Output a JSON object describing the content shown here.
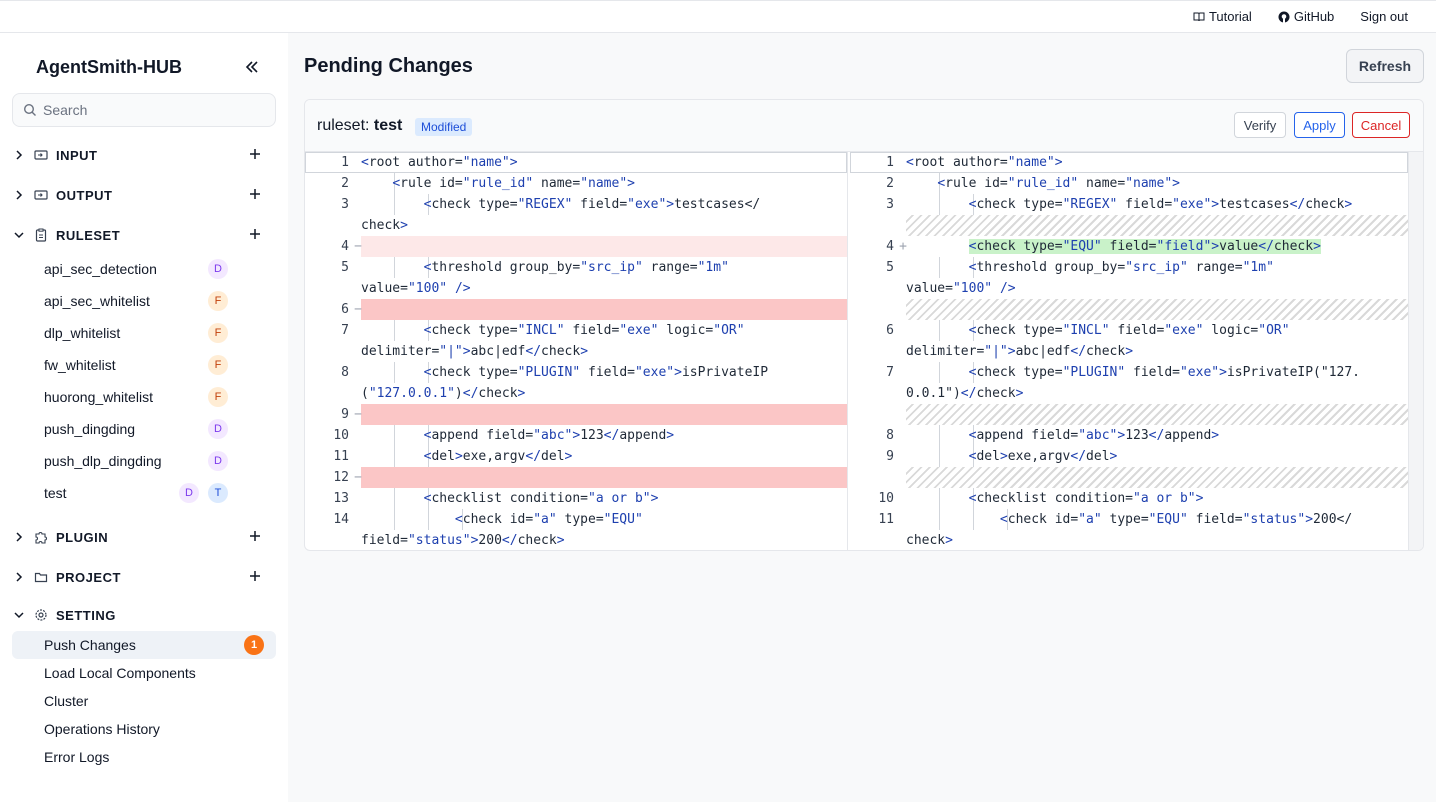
{
  "topbar": {
    "tutorial": "Tutorial",
    "github": "GitHub",
    "signout": "Sign out"
  },
  "sidebar": {
    "brand": "AgentSmith-HUB",
    "search_placeholder": "Search",
    "sections": {
      "input": "INPUT",
      "output": "OUTPUT",
      "ruleset": "RULESET",
      "plugin": "PLUGIN",
      "project": "PROJECT",
      "setting": "SETTING"
    },
    "rulesets": [
      {
        "label": "api_sec_detection",
        "badges": [
          "D"
        ]
      },
      {
        "label": "api_sec_whitelist",
        "badges": [
          "F"
        ]
      },
      {
        "label": "dlp_whitelist",
        "badges": [
          "F"
        ]
      },
      {
        "label": "fw_whitelist",
        "badges": [
          "F"
        ]
      },
      {
        "label": "huorong_whitelist",
        "badges": [
          "F"
        ]
      },
      {
        "label": "push_dingding",
        "badges": [
          "D"
        ]
      },
      {
        "label": "push_dlp_dingding",
        "badges": [
          "D"
        ]
      },
      {
        "label": "test",
        "badges": [
          "D",
          "T"
        ]
      }
    ],
    "settings": [
      {
        "label": "Push Changes",
        "count": "1"
      },
      {
        "label": "Load Local Components"
      },
      {
        "label": "Cluster"
      },
      {
        "label": "Operations History"
      },
      {
        "label": "Error Logs"
      }
    ]
  },
  "main": {
    "title": "Pending Changes",
    "refresh": "Refresh",
    "change": {
      "type_label": "ruleset:",
      "name": "test",
      "status": "Modified",
      "verify": "Verify",
      "apply": "Apply",
      "cancel": "Cancel"
    }
  },
  "diff": {
    "left": [
      {
        "n": "1",
        "mark": "",
        "text": "<root author=\"name\">"
      },
      {
        "n": "2",
        "mark": "",
        "text": "    <rule id=\"rule_id\" name=\"name\">"
      },
      {
        "n": "3",
        "mark": "",
        "text": "        <check type=\"REGEX\" field=\"exe\">testcases</"
      },
      {
        "n": "",
        "mark": "",
        "text": "check>"
      },
      {
        "n": "4",
        "mark": "−",
        "text": ""
      },
      {
        "n": "5",
        "mark": "",
        "text": "        <threshold group_by=\"src_ip\" range=\"1m\""
      },
      {
        "n": "",
        "mark": "",
        "text": "value=\"100\" />"
      },
      {
        "n": "6",
        "mark": "−",
        "text": ""
      },
      {
        "n": "7",
        "mark": "",
        "text": "        <check type=\"INCL\" field=\"exe\" logic=\"OR\""
      },
      {
        "n": "",
        "mark": "",
        "text": "delimiter=\"|\">abc|edf</check>"
      },
      {
        "n": "8",
        "mark": "",
        "text": "        <check type=\"PLUGIN\" field=\"exe\">isPrivateIP"
      },
      {
        "n": "",
        "mark": "",
        "text": "(\"127.0.0.1\")</check>"
      },
      {
        "n": "9",
        "mark": "−",
        "text": ""
      },
      {
        "n": "10",
        "mark": "",
        "text": "        <append field=\"abc\">123</append>"
      },
      {
        "n": "11",
        "mark": "",
        "text": "        <del>exe,argv</del>"
      },
      {
        "n": "12",
        "mark": "−",
        "text": ""
      },
      {
        "n": "13",
        "mark": "",
        "text": "        <checklist condition=\"a or b\">"
      },
      {
        "n": "14",
        "mark": "",
        "text": "            <check id=\"a\" type=\"EQU\""
      },
      {
        "n": "",
        "mark": "",
        "text": "field=\"status\">200</check>"
      }
    ],
    "right": [
      {
        "n": "1",
        "mark": "",
        "text": "<root author=\"name\">"
      },
      {
        "n": "2",
        "mark": "",
        "text": "    <rule id=\"rule_id\" name=\"name\">"
      },
      {
        "n": "3",
        "mark": "",
        "text": "        <check type=\"REGEX\" field=\"exe\">testcases</check>"
      },
      {
        "n": "",
        "mark": "",
        "text": ""
      },
      {
        "n": "4",
        "mark": "+",
        "text": "        <check type=\"EQU\" field=\"field\">value</check>"
      },
      {
        "n": "5",
        "mark": "",
        "text": "        <threshold group_by=\"src_ip\" range=\"1m\""
      },
      {
        "n": "",
        "mark": "",
        "text": "value=\"100\" />"
      },
      {
        "n": "",
        "mark": "",
        "text": ""
      },
      {
        "n": "6",
        "mark": "",
        "text": "        <check type=\"INCL\" field=\"exe\" logic=\"OR\""
      },
      {
        "n": "",
        "mark": "",
        "text": "delimiter=\"|\">abc|edf</check>"
      },
      {
        "n": "7",
        "mark": "",
        "text": "        <check type=\"PLUGIN\" field=\"exe\">isPrivateIP(\"127."
      },
      {
        "n": "",
        "mark": "",
        "text": "0.0.1\")</check>"
      },
      {
        "n": "",
        "mark": "",
        "text": ""
      },
      {
        "n": "8",
        "mark": "",
        "text": "        <append field=\"abc\">123</append>"
      },
      {
        "n": "9",
        "mark": "",
        "text": "        <del>exe,argv</del>"
      },
      {
        "n": "",
        "mark": "",
        "text": ""
      },
      {
        "n": "10",
        "mark": "",
        "text": "        <checklist condition=\"a or b\">"
      },
      {
        "n": "11",
        "mark": "",
        "text": "            <check id=\"a\" type=\"EQU\" field=\"status\">200</"
      },
      {
        "n": "",
        "mark": "",
        "text": "check>"
      }
    ]
  },
  "colors": {
    "accent": "#2563eb",
    "danger": "#dc2626",
    "deleted": "#fbc6c6",
    "deleted_light": "#fde8e8",
    "added": "#c9f2c9",
    "string": "#1e40af"
  }
}
